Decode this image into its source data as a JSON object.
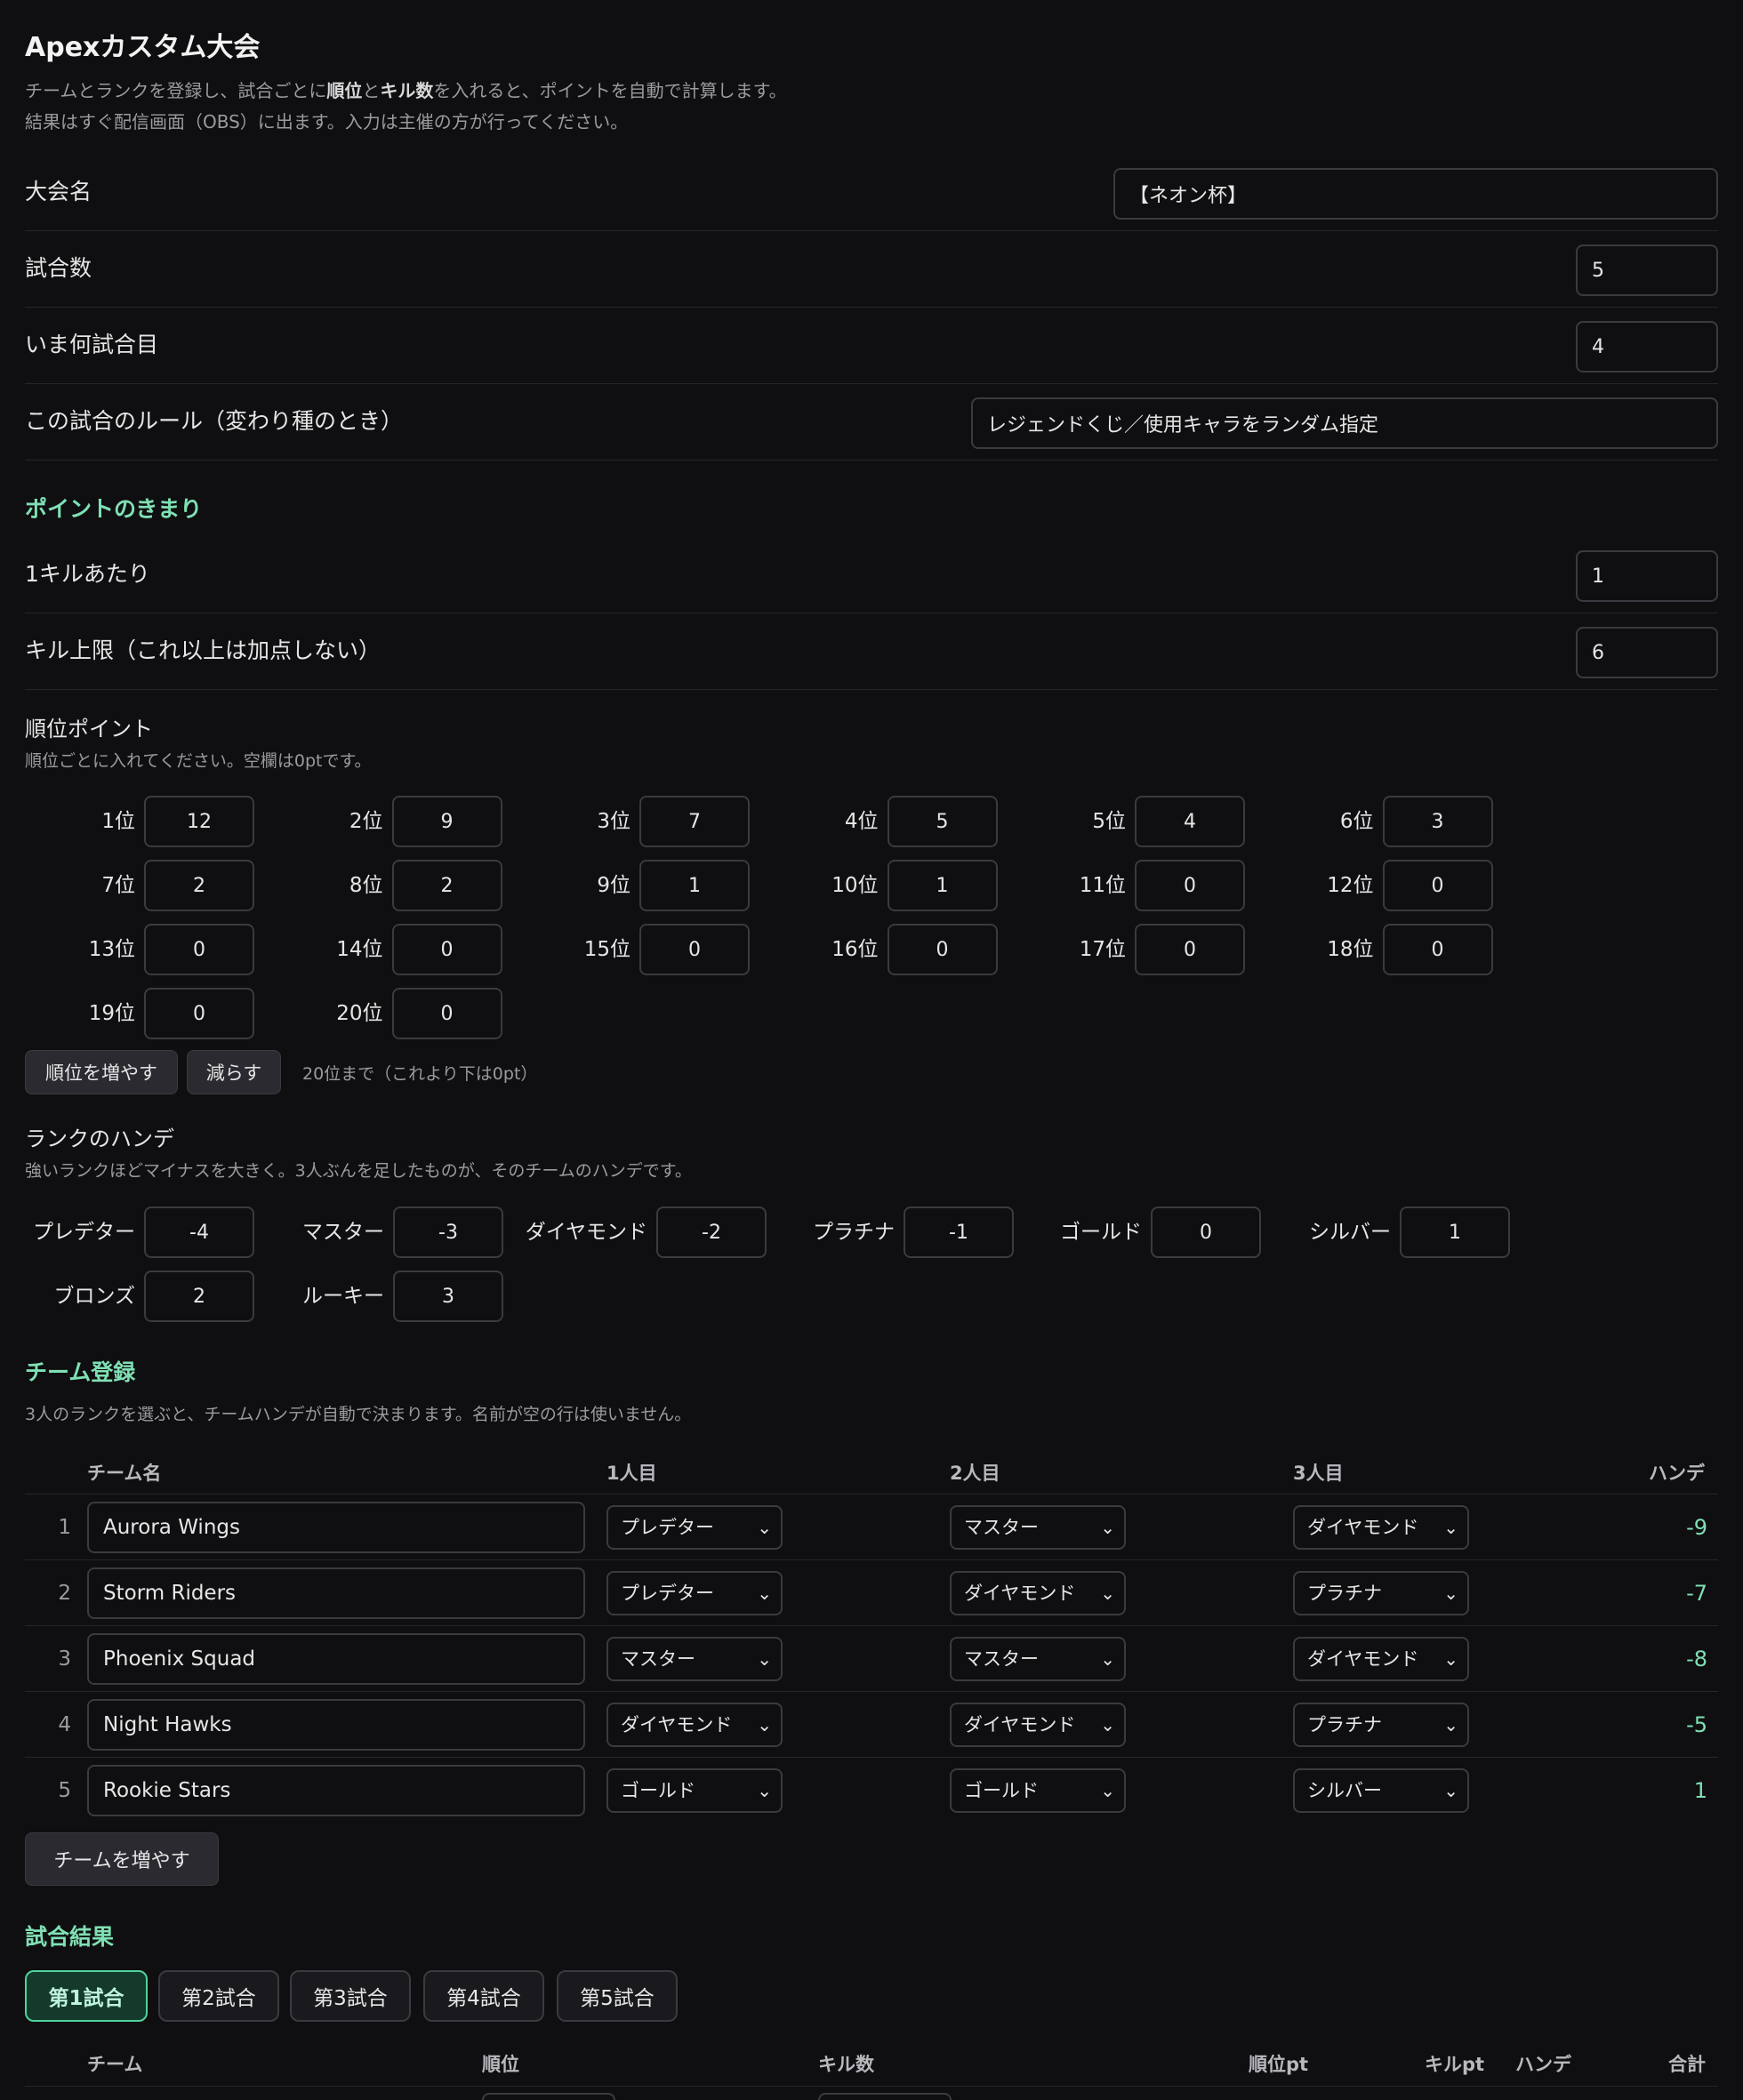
{
  "header": {
    "title": "Apexカスタム大会",
    "desc_line1_pre": "チームとランクを登録し、試合ごとに",
    "desc_line1_b1": "順位",
    "desc_line1_mid": "と",
    "desc_line1_b2": "キル数",
    "desc_line1_post": "を入れると、ポイントを自動で計算します。",
    "desc_line2": "結果はすぐ配信画面（OBS）に出ます。入力は主催の方が行ってください。"
  },
  "settings": {
    "tournament_name_label": "大会名",
    "tournament_name_value": "【ネオン杯】",
    "match_count_label": "試合数",
    "match_count_value": "5",
    "current_match_label": "いま何試合目",
    "current_match_value": "4",
    "rule_label": "この試合のルール（変わり種のとき）",
    "rule_value": "レジェンドくじ／使用キャラをランダム指定"
  },
  "points": {
    "section_title": "ポイントのきまり",
    "per_kill_label": "1キルあたり",
    "per_kill_value": "1",
    "kill_cap_label": "キル上限（これ以上は加点しない）",
    "kill_cap_value": "6",
    "placement_title": "順位ポイント",
    "placement_note": "順位ごとに入れてください。空欄は0ptです。",
    "placements": [
      {
        "label": "1位",
        "value": "12"
      },
      {
        "label": "2位",
        "value": "9"
      },
      {
        "label": "3位",
        "value": "7"
      },
      {
        "label": "4位",
        "value": "5"
      },
      {
        "label": "5位",
        "value": "4"
      },
      {
        "label": "6位",
        "value": "3"
      },
      {
        "label": "7位",
        "value": "2"
      },
      {
        "label": "8位",
        "value": "2"
      },
      {
        "label": "9位",
        "value": "1"
      },
      {
        "label": "10位",
        "value": "1"
      },
      {
        "label": "11位",
        "value": "0"
      },
      {
        "label": "12位",
        "value": "0"
      },
      {
        "label": "13位",
        "value": "0"
      },
      {
        "label": "14位",
        "value": "0"
      },
      {
        "label": "15位",
        "value": "0"
      },
      {
        "label": "16位",
        "value": "0"
      },
      {
        "label": "17位",
        "value": "0"
      },
      {
        "label": "18位",
        "value": "0"
      },
      {
        "label": "19位",
        "value": "0"
      },
      {
        "label": "20位",
        "value": "0"
      }
    ],
    "add_rank_label": "順位を増やす",
    "remove_rank_label": "減らす",
    "rank_limit_note": "20位まで（これより下は0pt）"
  },
  "handicap": {
    "title": "ランクのハンデ",
    "note": "強いランクほどマイナスを大きく。3人ぶんを足したものが、そのチームのハンデです。",
    "ranks": [
      {
        "label": "プレデター",
        "value": "-4"
      },
      {
        "label": "マスター",
        "value": "-3"
      },
      {
        "label": "ダイヤモンド",
        "value": "-2"
      },
      {
        "label": "プラチナ",
        "value": "-1"
      },
      {
        "label": "ゴールド",
        "value": "0"
      },
      {
        "label": "シルバー",
        "value": "1"
      },
      {
        "label": "ブロンズ",
        "value": "2"
      },
      {
        "label": "ルーキー",
        "value": "3"
      }
    ]
  },
  "teams": {
    "section_title": "チーム登録",
    "note": "3人のランクを選ぶと、チームハンデが自動で決まります。名前が空の行は使いません。",
    "headers": {
      "name": "チーム名",
      "p1": "1人目",
      "p2": "2人目",
      "p3": "3人目",
      "hande": "ハンデ"
    },
    "rows": [
      {
        "num": "1",
        "name": "Aurora Wings",
        "p1": "プレデター",
        "p2": "マスター",
        "p3": "ダイヤモンド",
        "hande": "-9"
      },
      {
        "num": "2",
        "name": "Storm Riders",
        "p1": "プレデター",
        "p2": "ダイヤモンド",
        "p3": "プラチナ",
        "hande": "-7"
      },
      {
        "num": "3",
        "name": "Phoenix Squad",
        "p1": "マスター",
        "p2": "マスター",
        "p3": "ダイヤモンド",
        "hande": "-8"
      },
      {
        "num": "4",
        "name": "Night Hawks",
        "p1": "ダイヤモンド",
        "p2": "ダイヤモンド",
        "p3": "プラチナ",
        "hande": "-5"
      },
      {
        "num": "5",
        "name": "Rookie Stars",
        "p1": "ゴールド",
        "p2": "ゴールド",
        "p3": "シルバー",
        "hande": "1"
      }
    ],
    "add_team_label": "チームを増やす"
  },
  "results": {
    "section_title": "試合結果",
    "tabs": [
      "第1試合",
      "第2試合",
      "第3試合",
      "第4試合",
      "第5試合"
    ],
    "headers": {
      "team": "チーム",
      "place": "順位",
      "kills": "キル数",
      "place_pt": "順位pt",
      "kill_pt": "キルpt",
      "hande": "ハンデ",
      "total": "合計"
    }
  }
}
